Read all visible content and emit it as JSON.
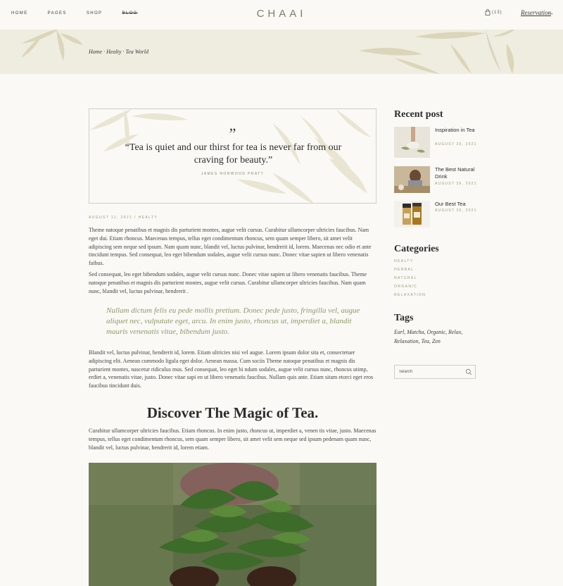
{
  "nav": {
    "items": [
      "HOME",
      "PAGES",
      "SHOP",
      "BLOG"
    ],
    "logo": "CHAAI",
    "cart_count": "(13)",
    "reservation": "Reservation",
    "reservation_arrow": "→"
  },
  "breadcrumb": "Home · Healty · Tea World",
  "quote": {
    "mark": "”",
    "text": "“Tea is quiet and our thirst for tea is never far from our craving for beauty.”",
    "author": "JAMES NORWOOD PRATT"
  },
  "post": {
    "meta": "AUGUST 11, 2021 / HEALTY",
    "paragraph1": "Theme natoque penatibus et magnis dis parturient montes, augue velit cursus. Curabitur ullamcorper ultricies faucibus. Nam eget dui. Etiam rhoncus. Maecenas tempus, tellus eget condimentum rhoncus, sem quam semper libero, sit amet velit adipiscing sem neque sed ipsum. Nam quam nunc, blandit vel, luctus pulvinar, hendrerit id, lorem. Maecenas nec odio et ante tincidunt tempus. Sed consequat, leo eget bibendum sodales, augue velit cursus nunc. Donec vitae sapien ut libero venenatis faibus.",
    "paragraph2": "Sed consequat, leo eget bibendum sodales, augue velit cursus nunc. Donec vitae sapien ut libero venenatis faucibus. Theme natoque penatibus et magnis dis parturient montes, augue velit cursus. Curabitur ullamcorper ultricies faucibus. Nam quam nunc, blandit vel, luctus pulvinar, hendrerit .",
    "pullquote": "Nullam dictum felis eu pede mollis pretium. Donec pede justo, fringilla vel, augue aliquet nec, vulputate eget, arcu. In enim justo, rhoncus ut, imperdiet a, blandit mauris venenatis vitae, bibendum justo.",
    "paragraph3": "Blandit vel, luctus pulvinar, hendrerit id, lorem. Etiam ultricies nisi vel augue. Lorem ipsum dolor sita et, consectetuer adipiscing elit. Aenean commodo ligula eget dolor. Aenean massa. Cum sociis Theme natoque penatibus et magnis dis parturient montes, nascetur ridiculus mus. Sed consequat, leo eget bi ndum sodales, augue velit cursus nunc, rhoncus utimp, erdiet a, venenatis vitae, justo. Donec vitae sapi en ut libero venenatis faucibus. Nullam quis ante. Etiam sitam etorci eget eros faucibus tincidunt duis.",
    "section_title": "Discover The Magic of Tea.",
    "paragraph4": "Curabitur ullamcorper ultricies faucibus. Etiam rhoncus. In enim justo, rhoncus ut, imperdiet a, venen tis vitae, justo. Maecenas tempus, tellus eget condimentum rhoncus, sem quam semper libero, sit amet velit sem neque sed ipsum pedenam quam nunc, blandit vel, luctus pulvinar, hendrerit id, lorem etiam."
  },
  "sidebar": {
    "recent_title": "Recent post",
    "recent_posts": [
      {
        "title": "Inspiration in Tea",
        "date": "AUGUST 26, 2021"
      },
      {
        "title": "The Best Natural Drink",
        "date": "AUGUST 26, 2021"
      },
      {
        "title": "Our Best Tea",
        "date": "AUGUST 26, 2021"
      }
    ],
    "categories_title": "Categories",
    "categories": [
      "HEALTY",
      "HERBAL",
      "NATURAL",
      "ORGANIC",
      "RELAXATION"
    ],
    "tags_title": "Tags",
    "tags": "Earl, Matcha, Organic, Relax, Relaxation, Tea, Zen",
    "search_placeholder": "Search"
  },
  "colors": {
    "accent": "#8c9a6c",
    "banner": "#efece0",
    "background": "#faf9f5"
  }
}
